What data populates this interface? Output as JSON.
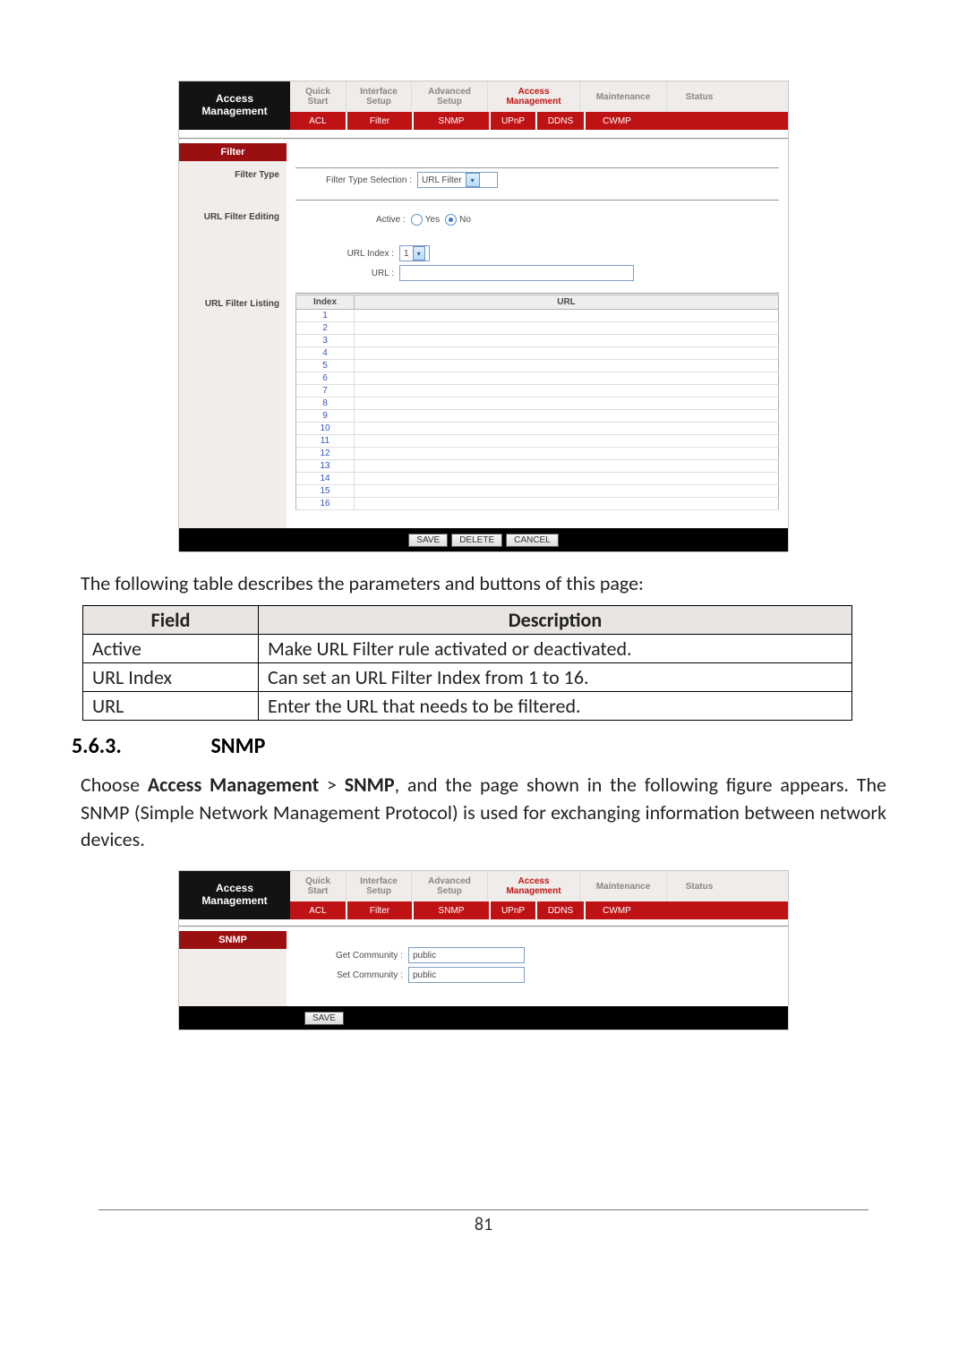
{
  "brand": {
    "line1": "Access",
    "line2": "Management"
  },
  "mainTabs": {
    "quickStart": "Quick\nStart",
    "interfaceSetup": "Interface\nSetup",
    "advancedSetup": "Advanced\nSetup",
    "accessManagement": "Access\nManagement",
    "maintenance": "Maintenance",
    "status": "Status"
  },
  "subTabs": {
    "acl": "ACL",
    "filter": "Filter",
    "snmp": "SNMP",
    "upnp": "UPnP",
    "ddns": "DDNS",
    "cwmp": "CWMP"
  },
  "filterPage": {
    "side": {
      "header": "Filter",
      "filterType": "Filter Type",
      "urlFilterEditing": "URL Filter Editing",
      "urlFilterListing": "URL Filter Listing"
    },
    "filterTypeSelectionLabel": "Filter Type Selection :",
    "filterTypeSelectionValue": "URL Filter",
    "activeLabel": "Active :",
    "activeYes": "Yes",
    "activeNo": "No",
    "urlIndexLabel": "URL Index :",
    "urlIndexValue": "1",
    "urlLabel": "URL :",
    "listHead": {
      "index": "Index",
      "url": "URL"
    },
    "listRows": [
      "1",
      "2",
      "3",
      "4",
      "5",
      "6",
      "7",
      "8",
      "9",
      "10",
      "11",
      "12",
      "13",
      "14",
      "15",
      "16"
    ],
    "buttons": {
      "save": "SAVE",
      "delete": "DELETE",
      "cancel": "CANCEL"
    }
  },
  "doc": {
    "paraIntro": "The following table describes the parameters and buttons of this page:",
    "table": {
      "field": "Field",
      "description": "Description",
      "rows": [
        {
          "f": "Active",
          "d": "Make URL Filter rule activated or deactivated."
        },
        {
          "f": "URL Index",
          "d": "Can set an URL Filter Index from 1 to 16."
        },
        {
          "f": "URL",
          "d": "Enter the URL that needs to be filtered."
        }
      ]
    },
    "sectionNumber": "5.6.3.",
    "sectionTitle": "SNMP",
    "snmpParaPrefix": "Choose ",
    "snmpParaBold1": "Access Management",
    "snmpParaMid": " > ",
    "snmpParaBold2": "SNMP",
    "snmpParaSuffix": ", and the page shown in the following figure appears. The SNMP (Simple Network Management Protocol) is used for exchanging information between network devices.",
    "pageNumber": "81"
  },
  "snmpPage": {
    "side": {
      "header": "SNMP"
    },
    "getCommunityLabel": "Get Community :",
    "getCommunityValue": "public",
    "setCommunityLabel": "Set Community :",
    "setCommunityValue": "public",
    "buttons": {
      "save": "SAVE"
    }
  }
}
